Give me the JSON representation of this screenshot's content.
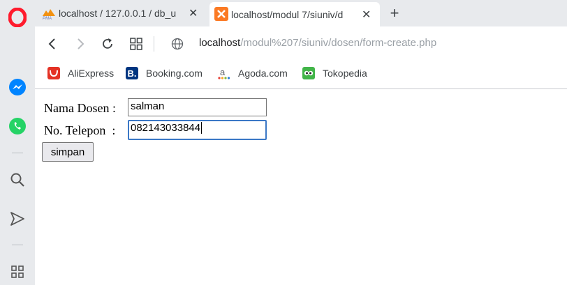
{
  "tabs": [
    {
      "title": "localhost / 127.0.0.1 / db_u",
      "favicon": "phpmyadmin-icon",
      "active": false
    },
    {
      "title": "localhost/modul 7/siuniv/d",
      "favicon": "xampp-icon",
      "active": true
    }
  ],
  "address_bar": {
    "host": "localhost",
    "path": "/modul%207/siuniv/dosen/form-create.php"
  },
  "bookmarks": [
    {
      "label": "AliExpress",
      "icon": "aliexpress-icon",
      "color": "#e43225"
    },
    {
      "label": "Booking.com",
      "icon": "booking-icon",
      "color": "#003580"
    },
    {
      "label": "Agoda.com",
      "icon": "agoda-icon",
      "color": "#5a6068"
    },
    {
      "label": "Tokopedia",
      "icon": "tokopedia-icon",
      "color": "#42b549"
    }
  ],
  "form": {
    "nama_label": "Nama Dosen :",
    "nama_value": "salman",
    "telepon_label": "No. Telepon  :",
    "telepon_value": "082143033844",
    "submit_label": "simpan"
  },
  "colors": {
    "sidebar_bg": "#e8eaed",
    "opera_red": "#ff1b2d",
    "messenger_blue": "#0084ff",
    "whatsapp_green": "#25d366",
    "focus_blue": "#3b78c6"
  }
}
